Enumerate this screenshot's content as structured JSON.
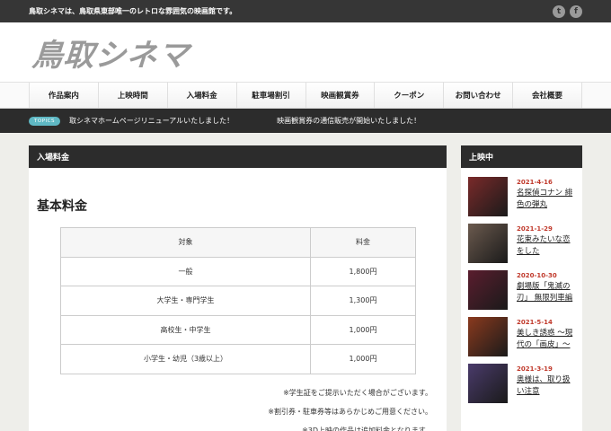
{
  "topbar": {
    "tagline": "鳥取シネマは、鳥取県東部唯一のレトロな雰囲気の映画館です。",
    "twitter_icon": "t",
    "facebook_icon": "f"
  },
  "header": {
    "logo": "鳥取シネマ"
  },
  "nav": [
    "作品案内",
    "上映時間",
    "入場料金",
    "駐車場割引",
    "映画観賞券",
    "クーポン",
    "お問い合わせ",
    "会社概要"
  ],
  "ticker": {
    "badge": "TOPICS",
    "items": [
      "取シネマホームページリニューアルいたしました！",
      "映画観賞券の通信販売が開始いたしました！"
    ]
  },
  "content": {
    "box_title": "入場料金",
    "section_title": "基本料金",
    "table": {
      "headers": [
        "対象",
        "料金"
      ],
      "rows": [
        [
          "一般",
          "1,800円"
        ],
        [
          "大学生・専門学生",
          "1,300円"
        ],
        [
          "高校生・中学生",
          "1,000円"
        ],
        [
          "小学生・幼児（3歳以上）",
          "1,000円"
        ]
      ]
    },
    "notes": [
      "※学生証をご提示いただく場合がございます。",
      "※割引券・駐車券等はあらかじめご用意ください。",
      "※3D上映の作品は追加料金となります。"
    ]
  },
  "sidebar": {
    "title": "上映中",
    "movies": [
      {
        "date": "2021-4-16",
        "title": "名探偵コナン 緋色の弾丸",
        "color": "#7a2a2a"
      },
      {
        "date": "2021-1-29",
        "title": "花束みたいな恋をした",
        "color": "#6b5a4e"
      },
      {
        "date": "2020-10-30",
        "title": "劇場版「鬼滅の刃」 無限列車編",
        "color": "#5a1d2e"
      },
      {
        "date": "2021-5-14",
        "title": "美しき誘惑 〜現代の「画皮」〜",
        "color": "#8a3a1e"
      },
      {
        "date": "2021-3-19",
        "title": "奥様は、取り扱い注意",
        "color": "#4a3b6b"
      }
    ]
  }
}
